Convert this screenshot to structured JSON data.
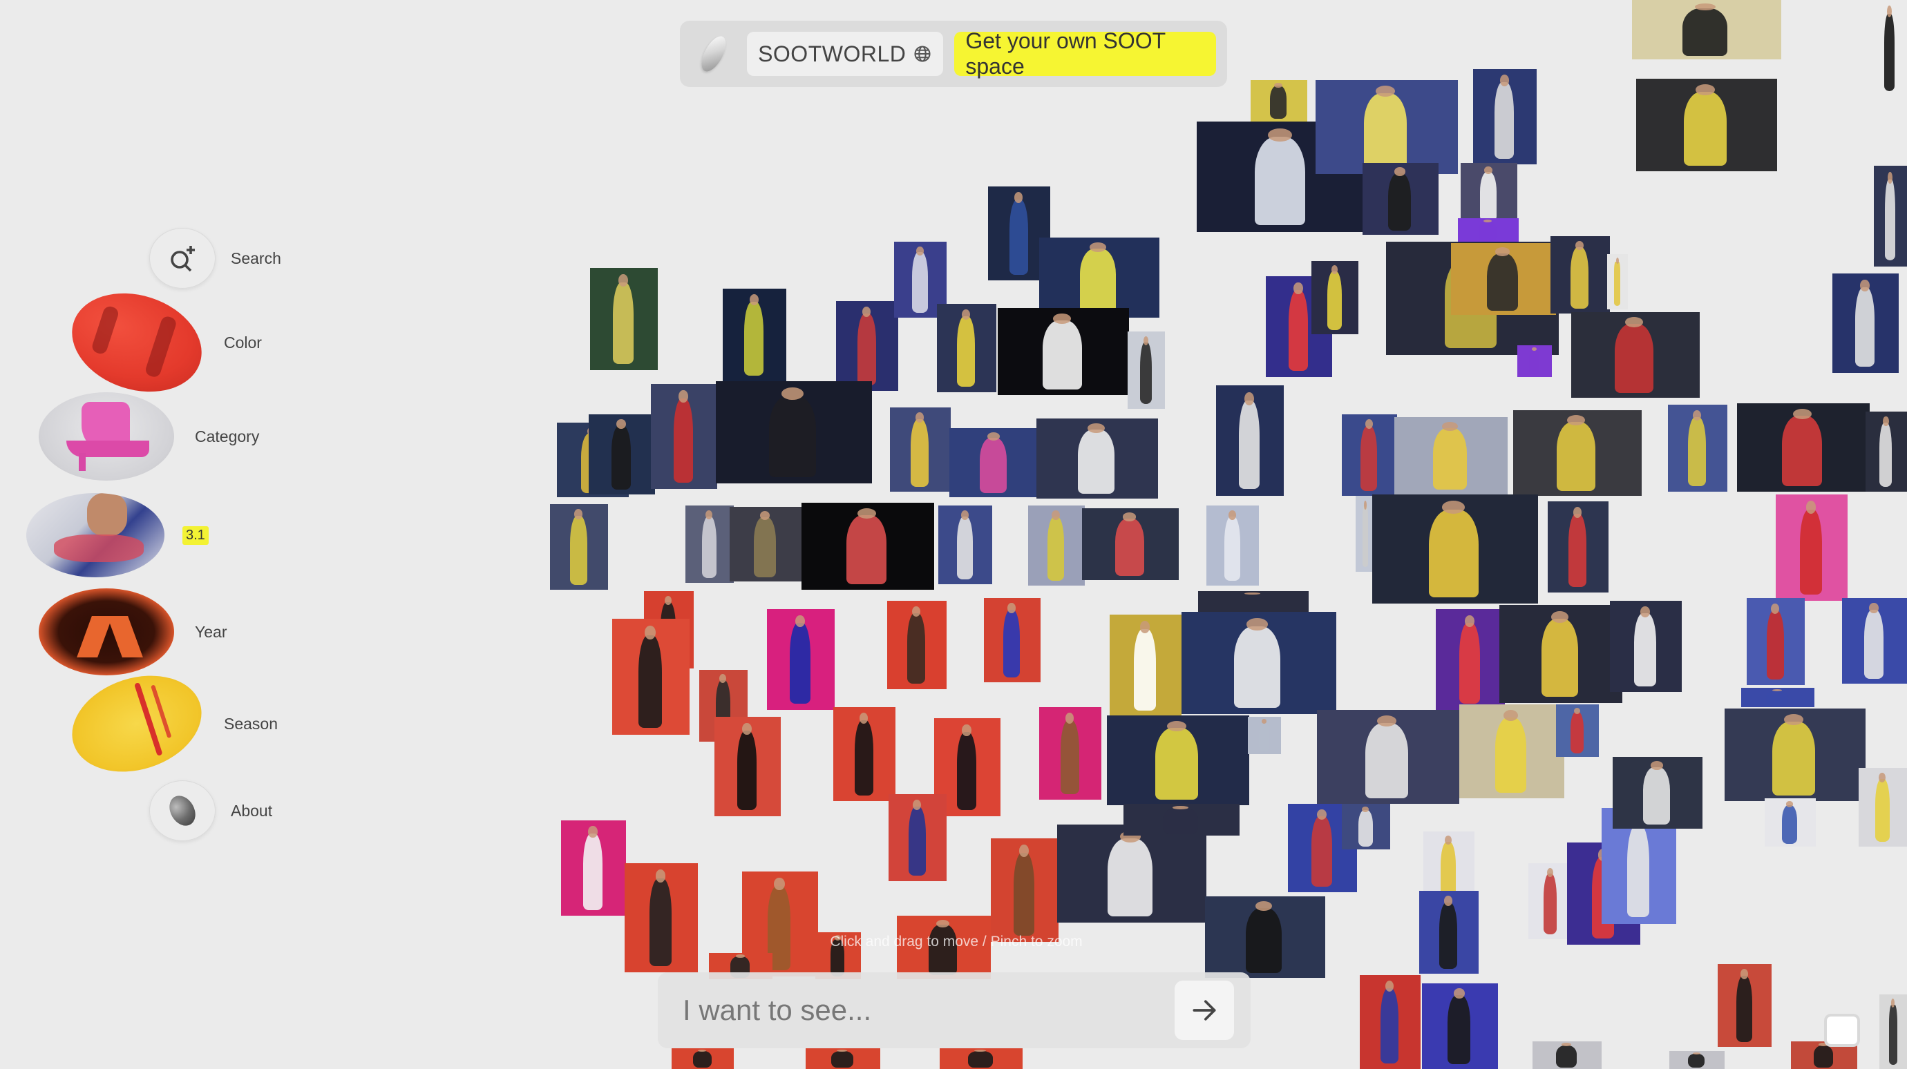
{
  "header": {
    "world_label": "SOOTWORLD",
    "cta_label": "Get your own SOOT space",
    "cta_color": "#f6f532"
  },
  "sidebar": {
    "search_label": "Search",
    "color_label": "Color",
    "category_label": "Category",
    "model_badge": "3.1",
    "year_label": "Year",
    "season_label": "Season",
    "about_label": "About"
  },
  "canvas": {
    "hint": "Click and drag to move / Pinch to zoom"
  },
  "prompt": {
    "placeholder": "I want to see..."
  }
}
